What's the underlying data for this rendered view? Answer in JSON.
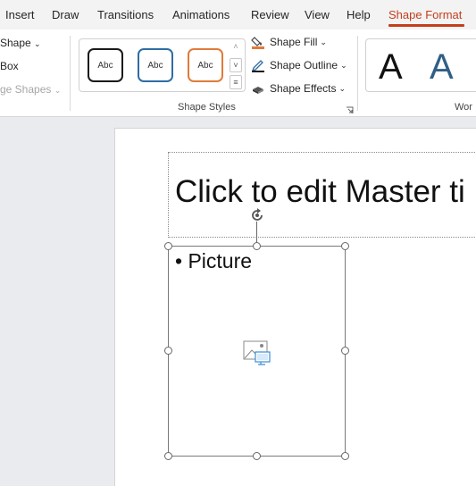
{
  "tabs": [
    "Insert",
    "Draw",
    "Transitions",
    "Animations",
    "Review",
    "View",
    "Help",
    "Shape Format"
  ],
  "active_tab": "Shape Format",
  "ribbon": {
    "insert_shapes": {
      "shape_label": "Shape",
      "box_label": "Box",
      "merge_shapes_label": "ge Shapes"
    },
    "shape_styles": {
      "gallery_items": [
        "Abc",
        "Abc",
        "Abc"
      ],
      "fill_label": "Shape Fill",
      "outline_label": "Shape Outline",
      "effects_label": "Shape Effects",
      "group_label": "Shape Styles"
    },
    "wordart": {
      "letters": [
        "A",
        "A"
      ],
      "group_label": "Wor"
    }
  },
  "slide": {
    "title_placeholder": "Click to edit Master ti",
    "bullet_char": "•",
    "picture_placeholder_label": "Picture"
  },
  "colors": {
    "accent": "#c43e1c",
    "outline_blue": "#2f6da4",
    "outline_orange": "#e07b39",
    "fill_orange": "#e07b39"
  }
}
